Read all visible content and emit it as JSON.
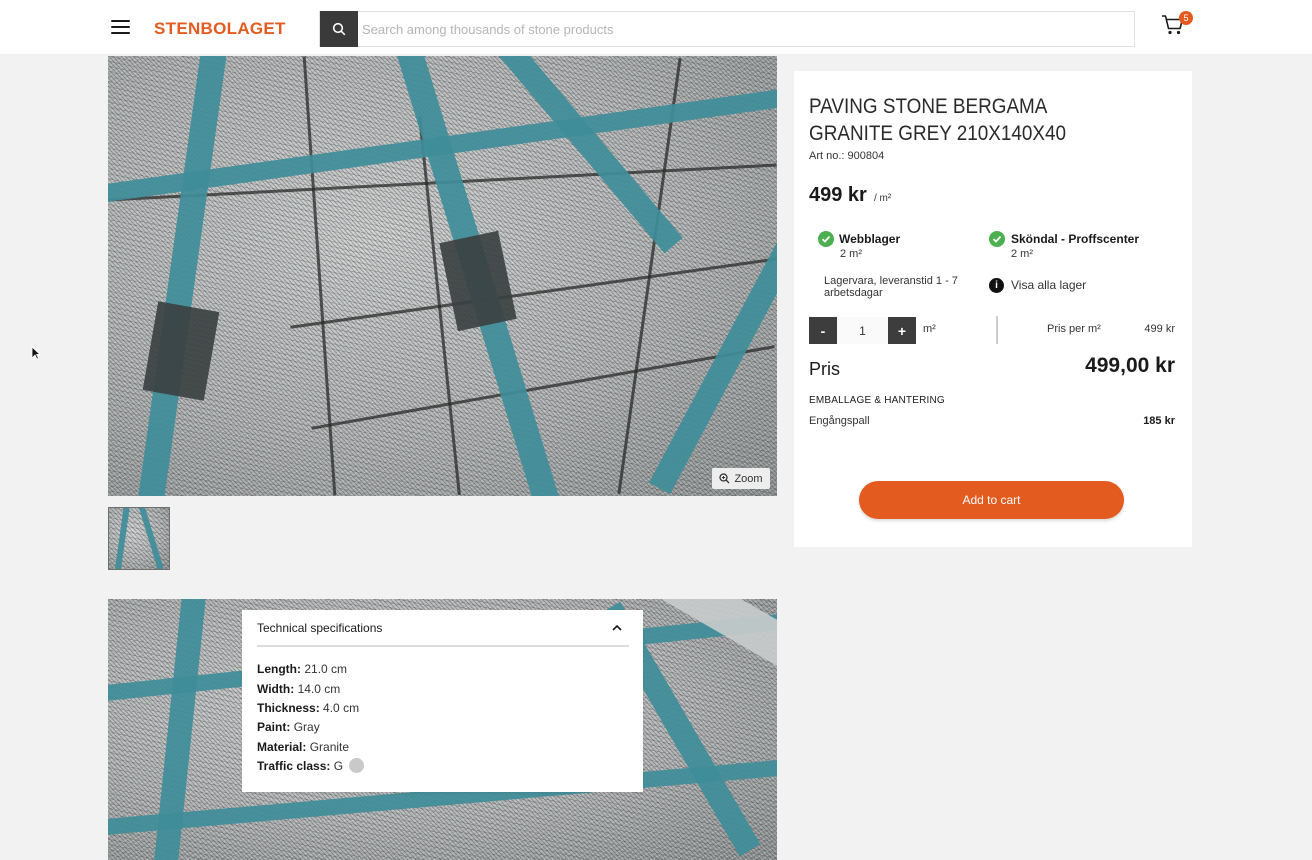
{
  "header": {
    "logo": "STENBOLAGET",
    "search_placeholder": "Search among thousands of stone products",
    "cart_count": "5",
    "icons": [
      "menu-icon",
      "search-icon",
      "cart-icon"
    ]
  },
  "gallery": {
    "zoom_label": "Zoom"
  },
  "product": {
    "title": "PAVING STONE BERGAMA GRANITE GREY 210X140X40",
    "art_no": "Art no.: 900804",
    "price": "499 kr",
    "price_unit": "/ m²",
    "stock": [
      {
        "name": "Webblager",
        "qty": "2 m²"
      },
      {
        "name": "Sköndal - Proffscenter",
        "qty": "2 m²"
      }
    ],
    "lead_time": "Lagervara, leveranstid 1 - 7 arbetsdagar",
    "show_all_stock": "Visa alla lager",
    "qty_minus": "-",
    "qty_plus": "+",
    "qty_value": "1",
    "qty_unit": "m²",
    "price_per_label": "Pris per m²",
    "price_per_value": "499 kr",
    "total_label": "Pris",
    "total_value": "499,00 kr",
    "packaging_label": "EMBALLAGE & HANTERING",
    "packaging_item": "Engångspall",
    "packaging_price": "185 kr",
    "add_to_cart": "Add to cart",
    "colors": {
      "accent": "#e35b1f",
      "in_stock": "#4caf50"
    }
  },
  "specs": {
    "heading": "Technical specifications",
    "rows": [
      {
        "label": "Length:",
        "value": "21.0 cm"
      },
      {
        "label": "Width:",
        "value": "14.0 cm"
      },
      {
        "label": "Thickness:",
        "value": "4.0 cm"
      },
      {
        "label": "Paint:",
        "value": "Gray"
      },
      {
        "label": "Material:",
        "value": "Granite"
      },
      {
        "label": "Traffic class:",
        "value": "G"
      }
    ]
  }
}
